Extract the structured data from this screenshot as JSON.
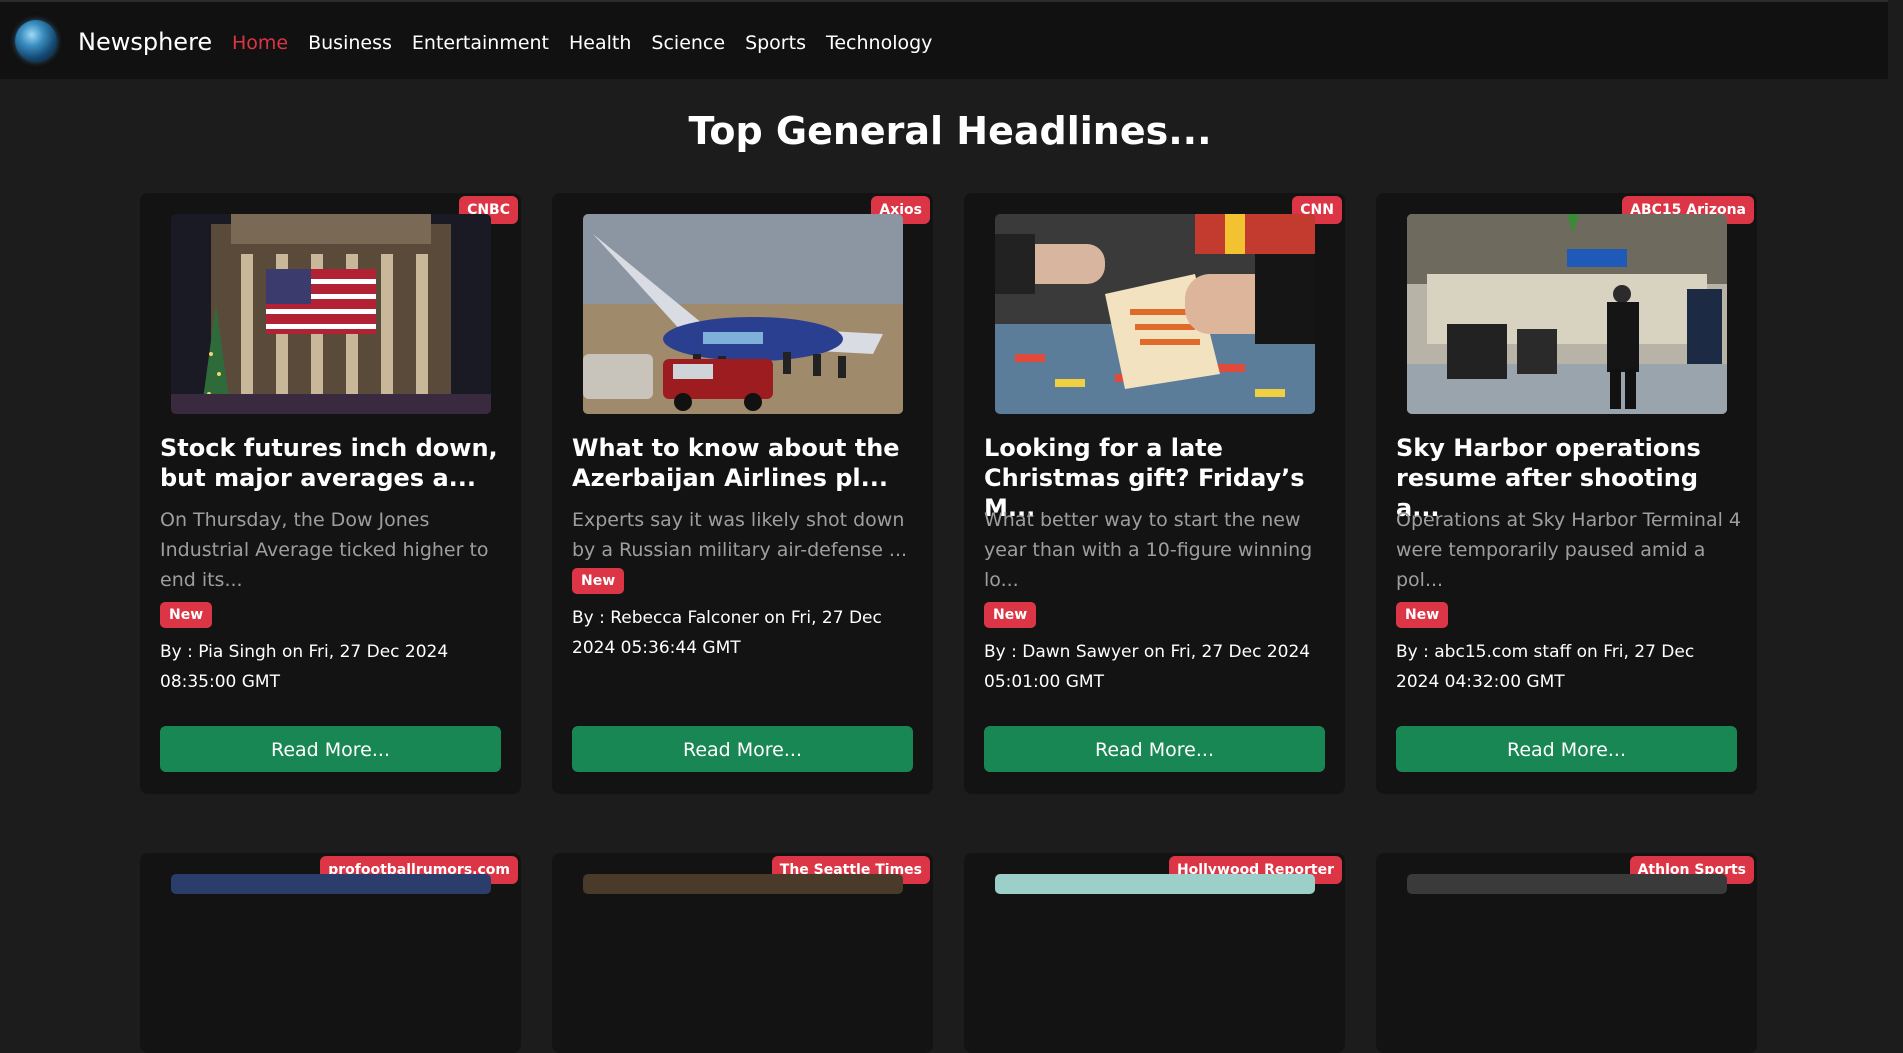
{
  "navbar": {
    "brand": "Newsphere",
    "items": [
      "Home",
      "Business",
      "Entertainment",
      "Health",
      "Science",
      "Sports",
      "Technology"
    ]
  },
  "heading": "Top General Headlines...",
  "cards": [
    {
      "source": "CNBC",
      "title": "Stock futures inch down, but major averages a...",
      "description": "On Thursday, the Dow Jones Industrial Average ticked higher to end its...",
      "new_label": "New",
      "byline": "By : Pia Singh on Fri, 27 Dec 2024 08:35:00 GMT",
      "button": "Read More..."
    },
    {
      "source": "Axios",
      "title": "What to know about the Azerbaijan Airlines pl...",
      "description": "Experts say it was likely shot down by a Russian military air-defense ...",
      "new_label": "New",
      "byline": "By : Rebecca Falconer on Fri, 27 Dec 2024 05:36:44 GMT",
      "button": "Read More..."
    },
    {
      "source": "CNN",
      "title": "Looking for a late Christmas gift? Friday’s M...",
      "description": "What better way to start the new year than with a 10-figure winning lo...",
      "new_label": "New",
      "byline": "By : Dawn Sawyer on Fri, 27 Dec 2024 05:01:00 GMT",
      "button": "Read More..."
    },
    {
      "source": "ABC15 Arizona",
      "title": "Sky Harbor operations resume after shooting a...",
      "description": "Operations at Sky Harbor Terminal 4 were temporarily paused amid a pol...",
      "new_label": "New",
      "byline": "By : abc15.com staff on Fri, 27 Dec 2024 04:32:00 GMT",
      "button": "Read More..."
    }
  ],
  "next_row_sources": [
    "profootballrumors.com",
    "The Seattle Times",
    "Hollywood Reporter",
    "Athlon Sports"
  ],
  "colors": {
    "accent_red": "#dc3545",
    "button_green": "#198754",
    "background": "#1c1c1c",
    "card": "#131313",
    "navbar": "#111111"
  }
}
